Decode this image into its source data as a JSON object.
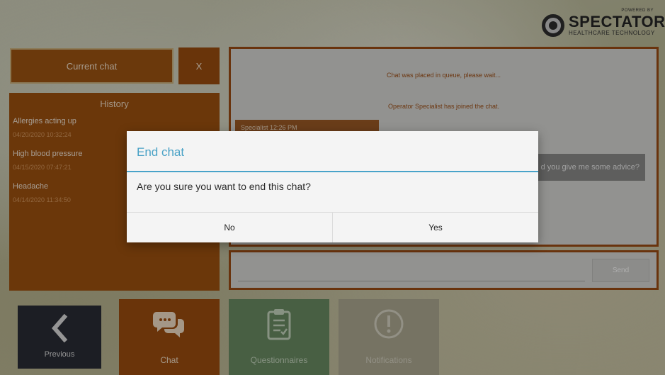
{
  "logo": {
    "powered_by": "POWERED BY",
    "brand": "SPECTATOR",
    "tagline": "HEALTHCARE TECHNOLOGY"
  },
  "current_chat": {
    "label": "Current chat",
    "close_label": "X"
  },
  "history": {
    "title": "History",
    "items": [
      {
        "title": "Allergies acting up",
        "date": "04/20/2020 10:32:24"
      },
      {
        "title": "High blood pressure",
        "date": "04/15/2020 07:47:21"
      },
      {
        "title": "Headache",
        "date": "04/14/2020 11:34:50"
      }
    ]
  },
  "chat": {
    "system_messages": [
      "Chat was placed in queue, please wait...",
      "Operator Specialist has joined the chat."
    ],
    "specialist_header": "Specialist    12:26 PM",
    "user_message_visible": "d you give me some advice?"
  },
  "input": {
    "send_label": "Send"
  },
  "nav": {
    "previous": "Previous",
    "chat": "Chat",
    "questionnaires": "Questionnaires",
    "notifications": "Notifications"
  },
  "dialog": {
    "title": "End chat",
    "message": "Are you sure you want to end this chat?",
    "no_label": "No",
    "yes_label": "Yes"
  },
  "colors": {
    "brand_brown": "#9b4c14",
    "dialog_accent": "#4aa2c6",
    "questionnaire_green": "#6b8d64"
  }
}
